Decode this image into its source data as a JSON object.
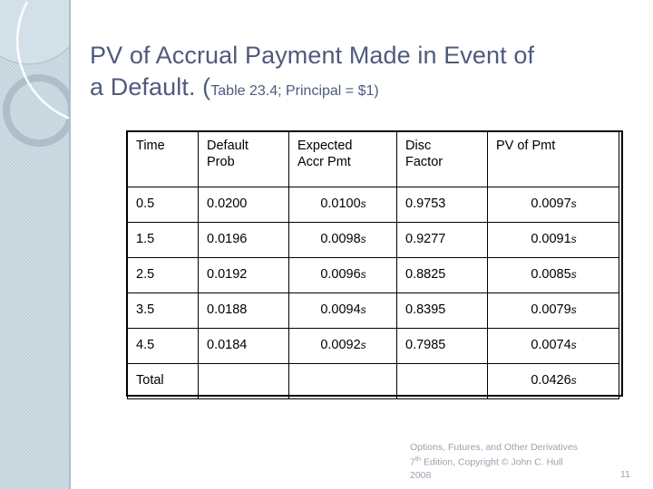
{
  "slide": {
    "title_line1": "PV of Accrual Payment Made in Event of",
    "title_line2_bold": "a Default. (",
    "title_line2_sub": "Table 23.4; Principal = $1)"
  },
  "table": {
    "headers": [
      "Time",
      "Default Prob",
      "Expected Accr Pmt",
      "Disc Factor",
      "PV of Pmt"
    ],
    "header_lines": {
      "h0a": "Time",
      "h0b": "",
      "h1a": "Default",
      "h1b": "Prob",
      "h2a": "Expected",
      "h2b": "Accr Pmt",
      "h3a": "Disc",
      "h3b": "Factor",
      "h4a": "PV of Pmt",
      "h4b": ""
    },
    "rows": [
      {
        "time": "0.5",
        "default_prob": "0.0200",
        "expected_accr_pmt": "0.0100",
        "expected_accr_pmt_suffix": "s",
        "disc_factor": "0.9753",
        "pv_of_pmt": "0.0097",
        "pv_of_pmt_suffix": "s"
      },
      {
        "time": "1.5",
        "default_prob": "0.0196",
        "expected_accr_pmt": "0.0098",
        "expected_accr_pmt_suffix": "s",
        "disc_factor": "0.9277",
        "pv_of_pmt": "0.0091",
        "pv_of_pmt_suffix": "s"
      },
      {
        "time": "2.5",
        "default_prob": "0.0192",
        "expected_accr_pmt": "0.0096",
        "expected_accr_pmt_suffix": "s",
        "disc_factor": "0.8825",
        "pv_of_pmt": "0.0085",
        "pv_of_pmt_suffix": "s"
      },
      {
        "time": "3.5",
        "default_prob": "0.0188",
        "expected_accr_pmt": "0.0094",
        "expected_accr_pmt_suffix": "s",
        "disc_factor": "0.8395",
        "pv_of_pmt": "0.0079",
        "pv_of_pmt_suffix": "s"
      },
      {
        "time": "4.5",
        "default_prob": "0.0184",
        "expected_accr_pmt": "0.0092",
        "expected_accr_pmt_suffix": "s",
        "disc_factor": "0.7985",
        "pv_of_pmt": "0.0074",
        "pv_of_pmt_suffix": "s"
      },
      {
        "time": "Total",
        "default_prob": "",
        "expected_accr_pmt": "",
        "expected_accr_pmt_suffix": "",
        "disc_factor": "",
        "pv_of_pmt": "0.0426",
        "pv_of_pmt_suffix": "s"
      }
    ]
  },
  "footer": {
    "line1": "Options, Futures, and Other Derivatives",
    "line2_pre": "7",
    "line2_sup": "th",
    "line2_post": " Edition, Copyright © John C. Hull",
    "line3": "2008",
    "page_number": "11"
  },
  "colors": {
    "title": "#515a7d",
    "sidebar": "#c2d4dd",
    "sidebar_edge": "#aebecb",
    "ring": "#a8b8c4",
    "footer_text": "#9aa3ad",
    "table_border": "#000000"
  }
}
